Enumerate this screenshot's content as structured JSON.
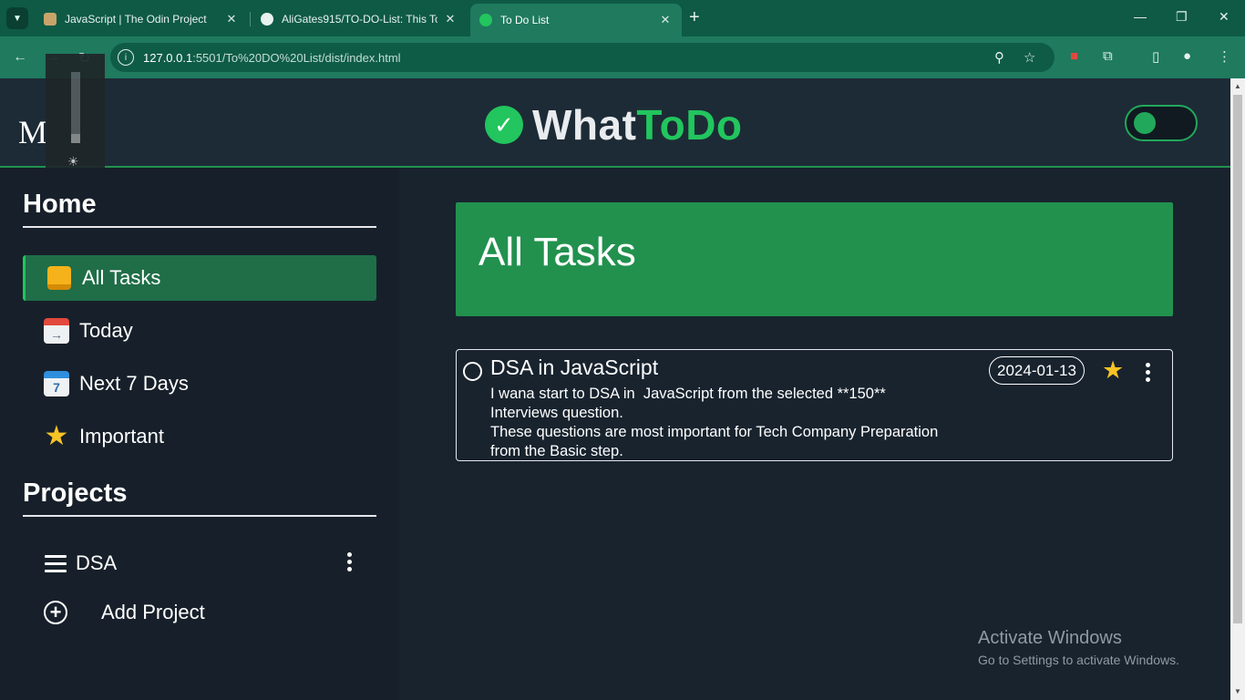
{
  "browser": {
    "tabs": [
      {
        "title": "JavaScript | The Odin Project"
      },
      {
        "title": "AliGates915/TO-DO-List: This To"
      },
      {
        "title": "To Do List"
      }
    ],
    "url_host": "127.0.0.1",
    "url_rest": ":5501/To%20DO%20List/dist/index.html"
  },
  "header": {
    "menu_letter": "M",
    "logo_part1": "What",
    "logo_part2": "ToDo"
  },
  "sidebar": {
    "home_title": "Home",
    "items": [
      {
        "label": "All Tasks",
        "icon": "inbox-tray-icon"
      },
      {
        "label": "Today",
        "icon": "calendar-icon"
      },
      {
        "label": "Next 7 Days",
        "icon": "calendar-7-icon",
        "icon_text": "7"
      },
      {
        "label": "Important",
        "icon": "star-icon"
      }
    ],
    "projects_title": "Projects",
    "projects": [
      {
        "label": "DSA"
      }
    ],
    "add_project": "Add Project"
  },
  "main": {
    "heading": "All Tasks",
    "tasks": [
      {
        "title": "DSA in JavaScript",
        "desc_line1": "I wana start to DSA in  JavaScript from the selected **150**",
        "desc_line2": "Interviews question.",
        "desc_line3": "These questions are most important for Tech Company Preparation",
        "desc_line4": "from the Basic step.",
        "date": "2024-01-13",
        "important": true
      }
    ]
  },
  "watermark": {
    "line1": "Activate Windows",
    "line2": "Go to Settings to activate Windows."
  },
  "colors": {
    "accent": "#22c55e",
    "banner": "#22914e",
    "star": "#f7c325"
  }
}
